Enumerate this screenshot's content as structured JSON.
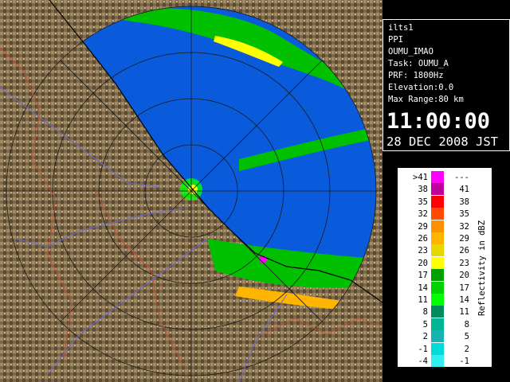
{
  "info": {
    "radar_id": "ilts1",
    "scan_type": "PPI",
    "site": "OUMU_IMAO",
    "task": "Task: OUMU_A",
    "prf": "PRF: 1800Hz",
    "elevation": "Elevation:0.0",
    "max_range": "Max Range:80 km",
    "time": "11:00:00",
    "date": "28 DEC 2008 JST"
  },
  "legend": {
    "unit_label": "Reflectivity in dBZ",
    "rows": [
      {
        "lo": ">41",
        "hi": "---",
        "color": "#ff00ff"
      },
      {
        "lo": "38",
        "hi": "41",
        "color": "#c0009a"
      },
      {
        "lo": "35",
        "hi": "38",
        "color": "#ff0000"
      },
      {
        "lo": "32",
        "hi": "35",
        "color": "#ff4a00"
      },
      {
        "lo": "29",
        "hi": "32",
        "color": "#ff9000"
      },
      {
        "lo": "26",
        "hi": "29",
        "color": "#ffb400"
      },
      {
        "lo": "23",
        "hi": "26",
        "color": "#e6d700"
      },
      {
        "lo": "20",
        "hi": "23",
        "color": "#ffff00"
      },
      {
        "lo": "17",
        "hi": "20",
        "color": "#00a000"
      },
      {
        "lo": "14",
        "hi": "17",
        "color": "#00d200"
      },
      {
        "lo": "11",
        "hi": "14",
        "color": "#00ff00"
      },
      {
        "lo": "8",
        "hi": "11",
        "color": "#008c5a"
      },
      {
        "lo": "5",
        "hi": "8",
        "color": "#00b496"
      },
      {
        "lo": "2",
        "hi": "5",
        "color": "#14b4b4"
      },
      {
        "lo": "-1",
        "hi": "2",
        "color": "#00dcdc"
      },
      {
        "lo": "-4",
        "hi": "-1",
        "color": "#32f0f0"
      }
    ]
  },
  "colors": {
    "radar_background": "#0a5adc",
    "land": "#7a6648",
    "rivers": "#6a6ad8",
    "boundaries": "#c84a3a"
  }
}
